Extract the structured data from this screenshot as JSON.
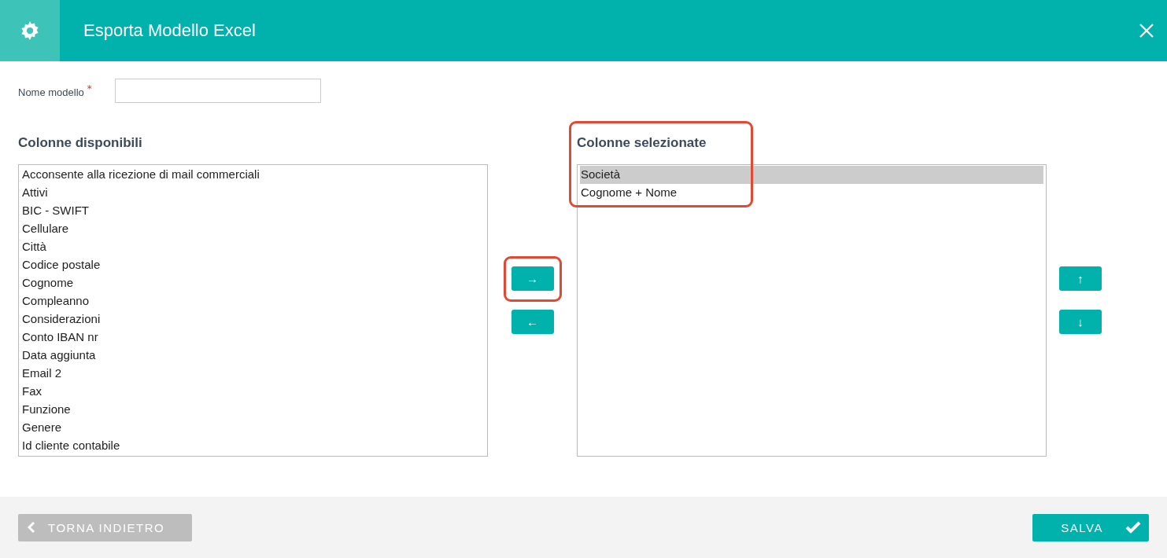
{
  "window": {
    "title": "Esporta Modello Excel"
  },
  "form": {
    "name_label": "Nome modello",
    "required_mark": "*"
  },
  "available": {
    "heading": "Colonne disponibili",
    "annotated": false,
    "items": [
      {
        "label": "Acconsente alla ricezione di mail commerciali",
        "selected": false
      },
      {
        "label": "Attivi",
        "selected": false
      },
      {
        "label": "BIC - SWIFT",
        "selected": false
      },
      {
        "label": "Cellulare",
        "selected": false
      },
      {
        "label": "Città",
        "selected": false
      },
      {
        "label": "Codice postale",
        "selected": false
      },
      {
        "label": "Cognome",
        "selected": false
      },
      {
        "label": "Compleanno",
        "selected": false
      },
      {
        "label": "Considerazioni",
        "selected": false
      },
      {
        "label": "Conto IBAN nr",
        "selected": false
      },
      {
        "label": "Data aggiunta",
        "selected": false
      },
      {
        "label": "Email 2",
        "selected": false
      },
      {
        "label": "Fax",
        "selected": false
      },
      {
        "label": "Funzione",
        "selected": false
      },
      {
        "label": "Genere",
        "selected": false
      },
      {
        "label": "Id cliente contabile",
        "selected": false
      }
    ]
  },
  "transfer_buttons": [
    {
      "symbol": "→",
      "annotated": true
    },
    {
      "symbol": "←",
      "annotated": false
    }
  ],
  "selected_columns": {
    "heading": "Colonne selezionate",
    "annotated": true,
    "items": [
      {
        "label": "Società",
        "selected": true
      },
      {
        "label": "Cognome + Nome",
        "selected": false
      }
    ]
  },
  "order_buttons": [
    {
      "symbol": "↑"
    },
    {
      "symbol": "↓"
    }
  ],
  "footer": {
    "back": "TORNA INDIETRO",
    "save": "SALVA"
  }
}
